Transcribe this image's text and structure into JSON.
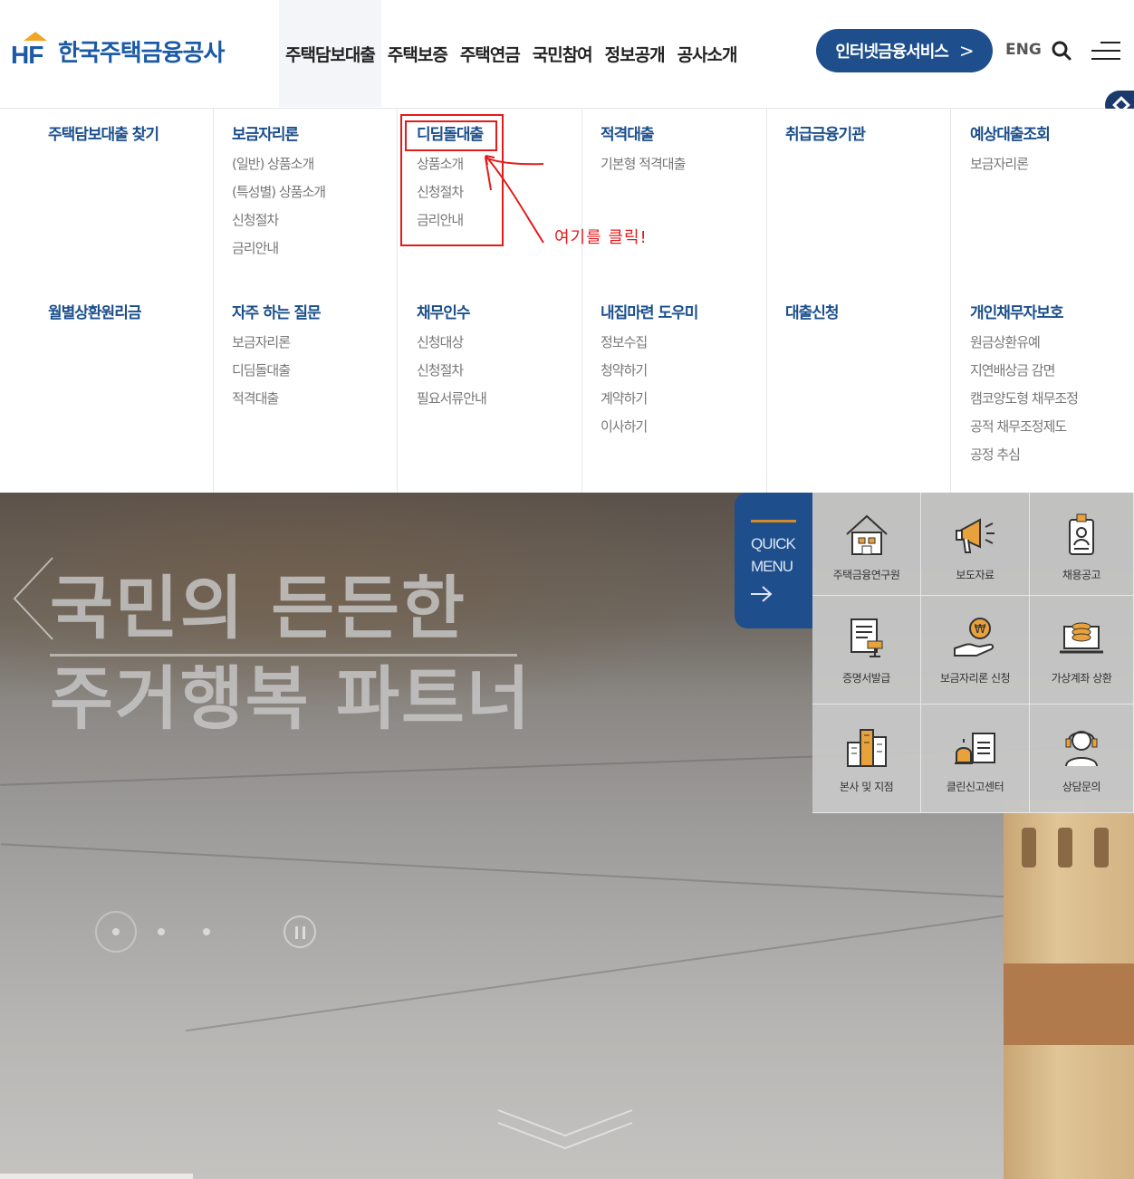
{
  "header": {
    "logo_text": "한국주택금융공사",
    "logo_mark": "HF",
    "nav": [
      "주택담보대출",
      "주택보증",
      "주택연금",
      "국민참여",
      "정보공개",
      "공사소개"
    ],
    "net_service_label": "인터넷금융서비스",
    "net_service_chevron": ">",
    "eng_label": "ENG",
    "icons": {
      "search": "search-icon",
      "menu": "hamburger-menu-icon",
      "side": "diamond-icon"
    }
  },
  "mega_menu": {
    "row1": [
      {
        "title": "주택담보대출 찾기",
        "items": []
      },
      {
        "title": "보금자리론",
        "items": [
          "(일반) 상품소개",
          "(특성별) 상품소개",
          "신청절차",
          "금리안내"
        ]
      },
      {
        "title": "디딤돌대출",
        "items": [
          "상품소개",
          "신청절차",
          "금리안내"
        ]
      },
      {
        "title": "적격대출",
        "items": [
          "기본형 적격대출"
        ]
      },
      {
        "title": "취급금융기관",
        "items": []
      },
      {
        "title": "예상대출조회",
        "items": [
          "보금자리론"
        ]
      }
    ],
    "row2": [
      {
        "title": "월별상환원리금",
        "items": []
      },
      {
        "title": "자주 하는 질문",
        "items": [
          "보금자리론",
          "디딤돌대출",
          "적격대출"
        ]
      },
      {
        "title": "채무인수",
        "items": [
          "신청대상",
          "신청절차",
          "필요서류안내"
        ]
      },
      {
        "title": "내집마련 도우미",
        "items": [
          "정보수집",
          "청약하기",
          "계약하기",
          "이사하기"
        ]
      },
      {
        "title": "대출신청",
        "items": []
      },
      {
        "title": "개인채무자보호",
        "items": [
          "원금상환유예",
          "지연배상금 감면",
          "캠코양도형 채무조정",
          "공적 채무조정제도",
          "공정 추심"
        ]
      }
    ]
  },
  "annotation": {
    "text": "여기를 클릭!",
    "color": "#e31b1b"
  },
  "hero": {
    "title_line1": "국민의 든든한",
    "title_line2": "주거행복 파트너"
  },
  "quick_menu": {
    "tab_line1": "QUICK",
    "tab_line2": "MENU",
    "items": [
      {
        "label": "주택금융연구원",
        "icon": "house-building-icon"
      },
      {
        "label": "보도자료",
        "icon": "megaphone-icon"
      },
      {
        "label": "채용공고",
        "icon": "id-badge-icon"
      },
      {
        "label": "증명서발급",
        "icon": "document-stamp-icon"
      },
      {
        "label": "보금자리론 신청",
        "icon": "hand-coin-icon"
      },
      {
        "label": "가상계좌 상환",
        "icon": "laptop-coins-icon"
      },
      {
        "label": "본사 및 지점",
        "icon": "office-buildings-icon"
      },
      {
        "label": "클린신고센터",
        "icon": "siren-report-icon"
      },
      {
        "label": "상담문의",
        "icon": "headset-agent-icon"
      }
    ]
  },
  "colors": {
    "brand_blue": "#1b4f8c",
    "button_blue": "#1e4f8c",
    "accent_orange": "#d38a2a"
  }
}
